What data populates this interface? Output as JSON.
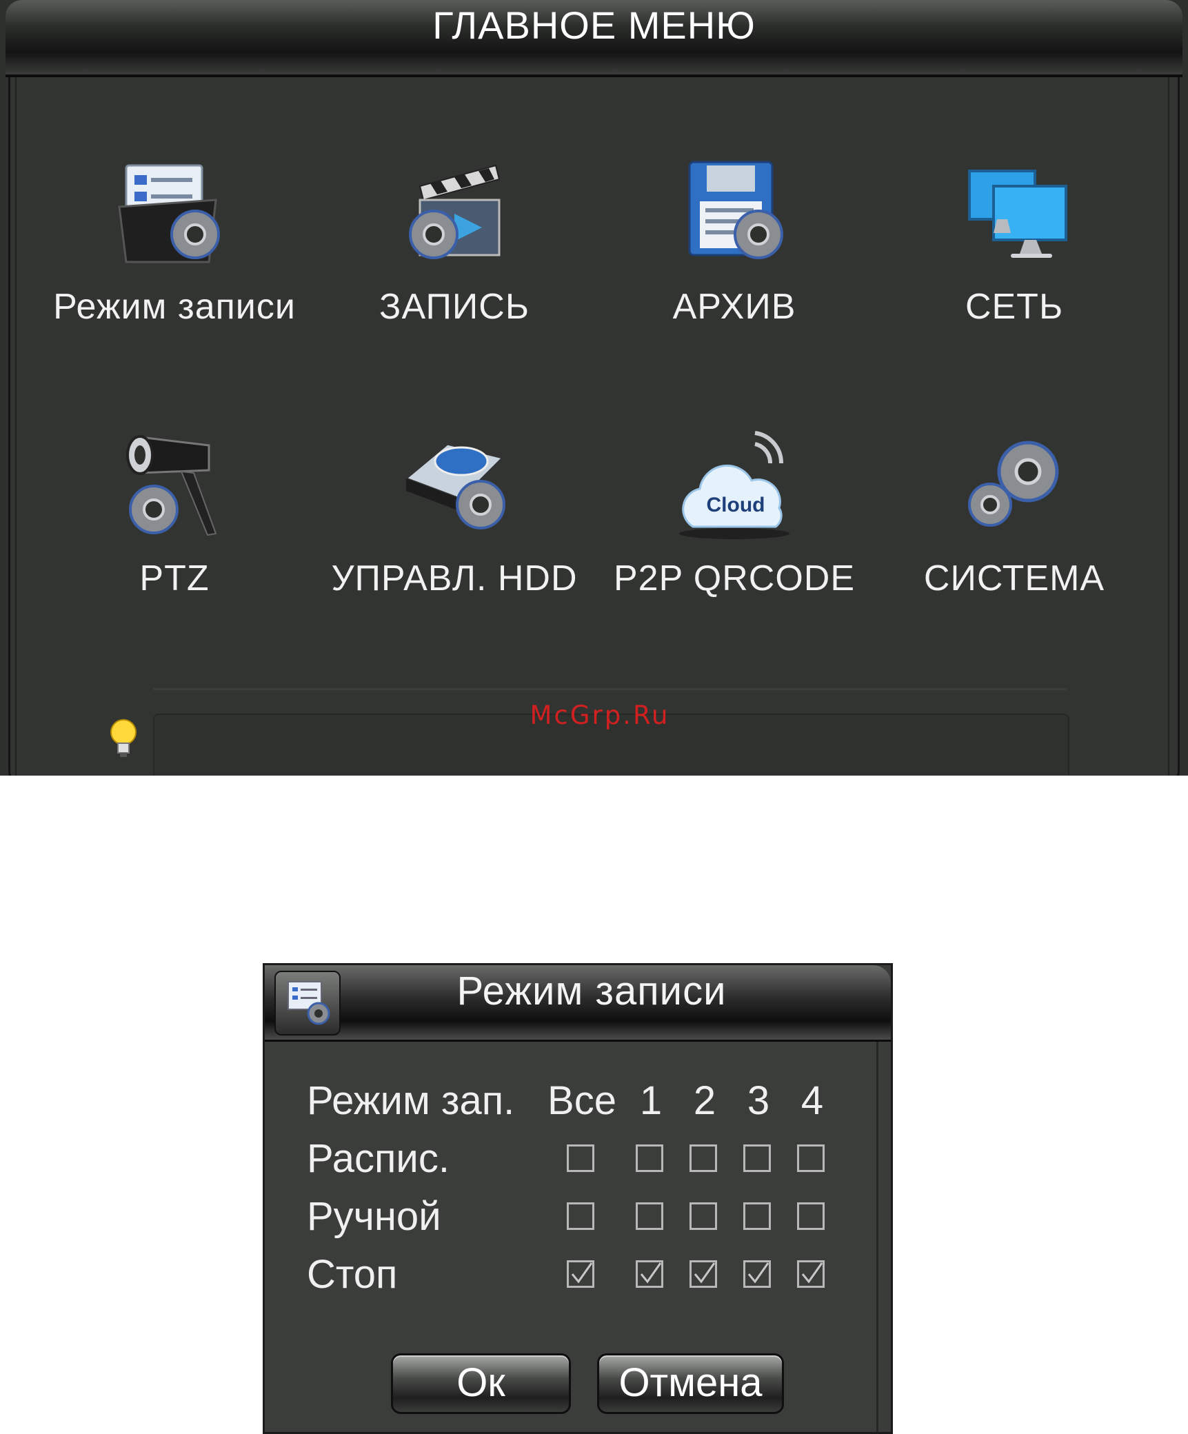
{
  "main_menu": {
    "title": "ГЛАВНОЕ МЕНЮ",
    "items": [
      {
        "label": "Режим записи",
        "icon": "record-mode-icon"
      },
      {
        "label": "ЗАПИСЬ",
        "icon": "recording-clapper-icon"
      },
      {
        "label": "АРХИВ",
        "icon": "archive-floppy-icon"
      },
      {
        "label": "СЕТЬ",
        "icon": "network-monitors-icon"
      },
      {
        "label": "PTZ",
        "icon": "ptz-camera-icon"
      },
      {
        "label": "УПРАВЛ. HDD",
        "icon": "hdd-management-icon"
      },
      {
        "label": "P2P QRCODE",
        "icon": "cloud-icon",
        "icon_text": "Cloud"
      },
      {
        "label": "СИСТЕМА",
        "icon": "system-gears-icon"
      }
    ],
    "tip_icon": "lightbulb-icon",
    "watermark": "McGrp.Ru"
  },
  "record_mode_dialog": {
    "title": "Режим записи",
    "header_label": "Режим зап.",
    "columns": [
      "Все",
      "1",
      "2",
      "3",
      "4"
    ],
    "rows": [
      {
        "label": "Распис.",
        "checked": [
          false,
          false,
          false,
          false,
          false
        ]
      },
      {
        "label": "Ручной",
        "checked": [
          false,
          false,
          false,
          false,
          false
        ]
      },
      {
        "label": "Стоп",
        "checked": [
          true,
          true,
          true,
          true,
          true
        ]
      }
    ],
    "ok_label": "Ок",
    "cancel_label": "Отмена"
  },
  "colors": {
    "background": "#323432",
    "text": "#f2f2f2",
    "watermark": "#d22020"
  }
}
